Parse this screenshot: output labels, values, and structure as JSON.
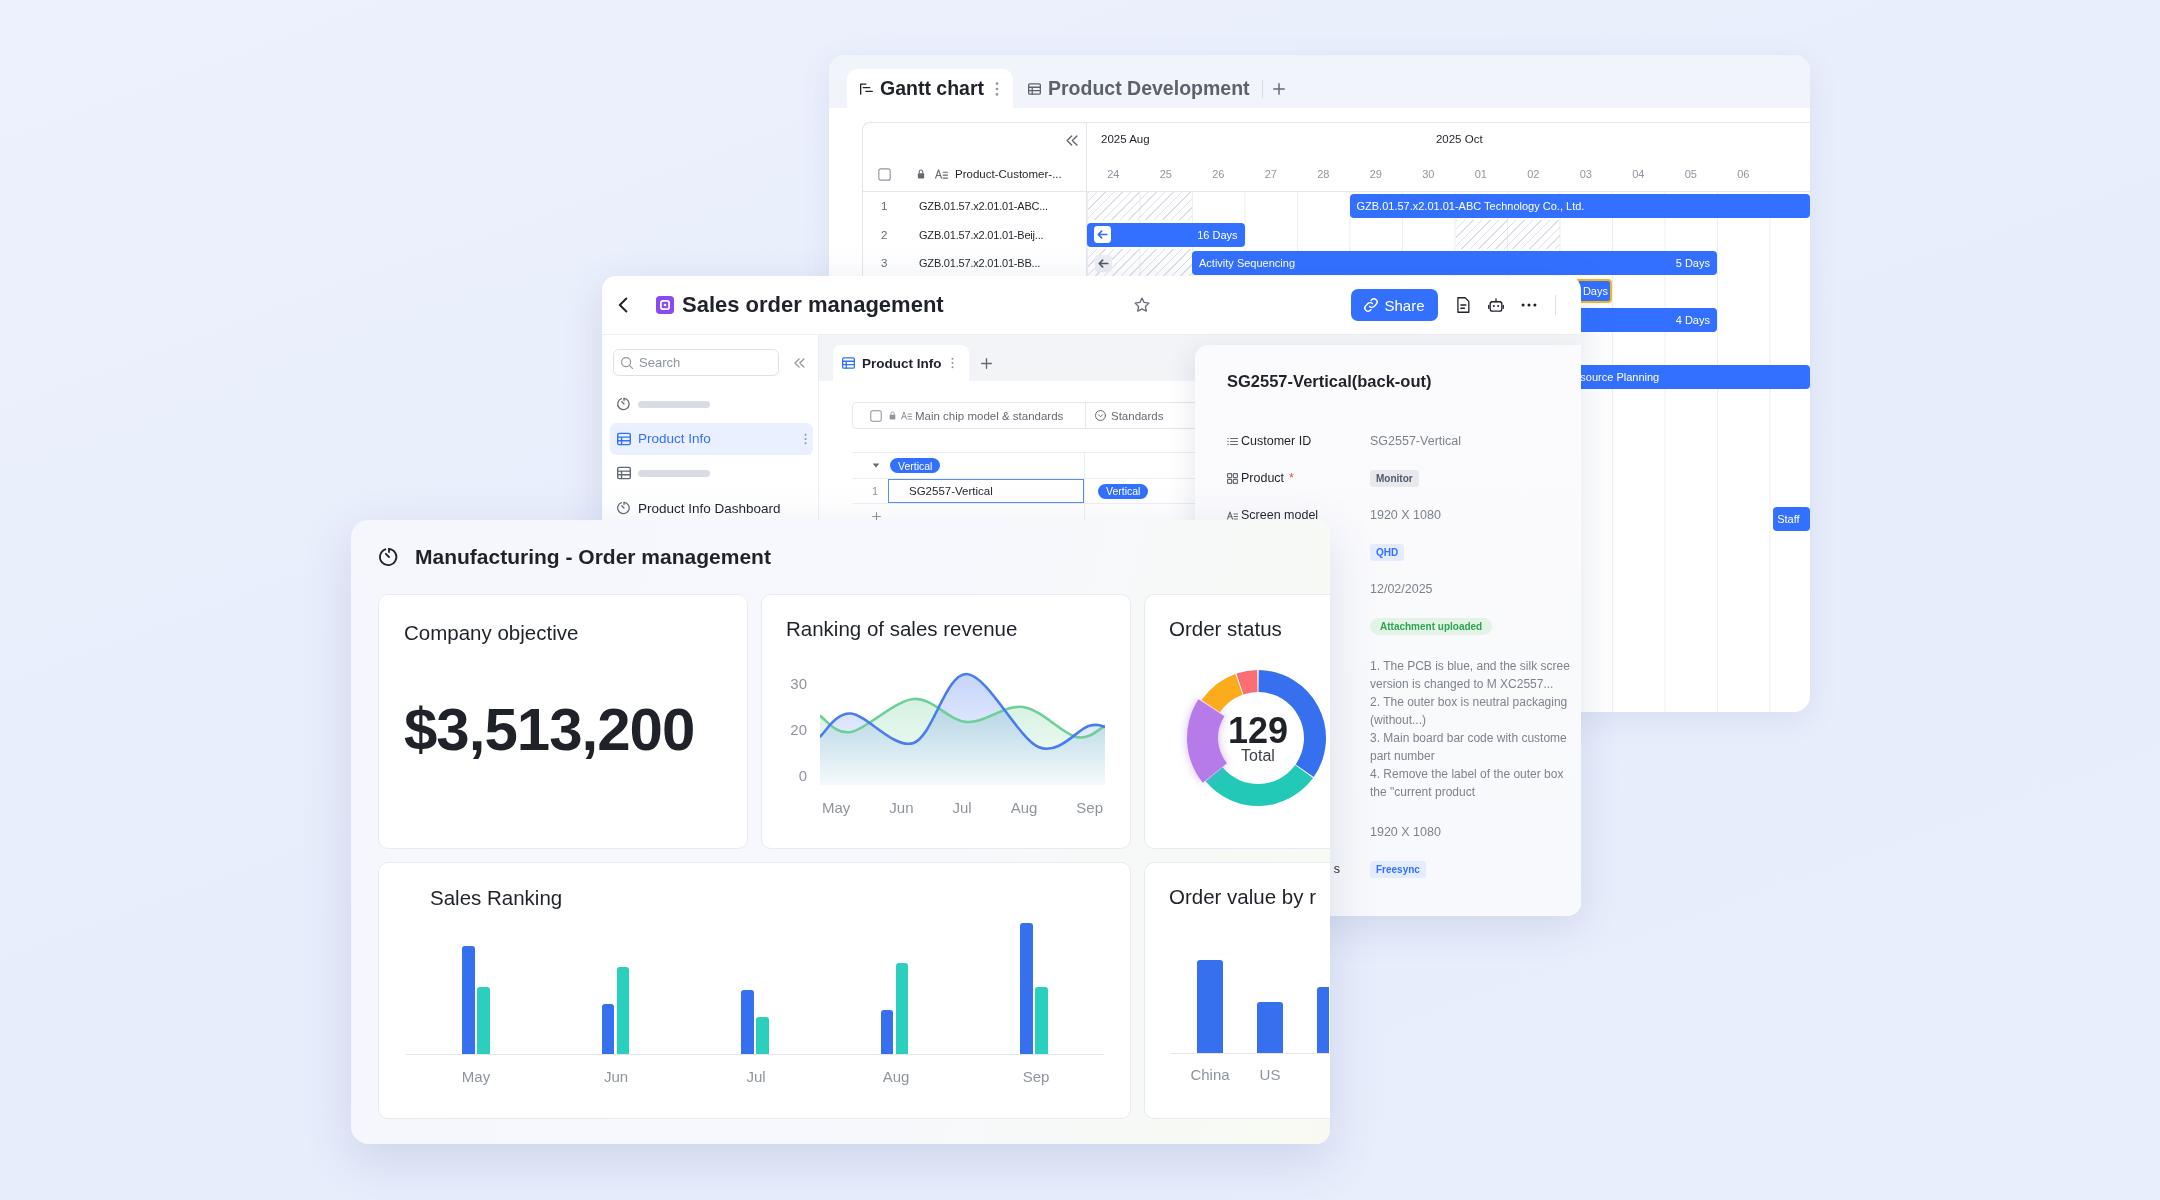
{
  "gantt_window": {
    "tabs": [
      {
        "kind": "gantt",
        "label": "Gantt chart",
        "selected": true
      },
      {
        "kind": "grid",
        "label": "Product Development",
        "selected": false
      }
    ],
    "timeline": {
      "months": [
        "2025 Aug",
        "2025 Oct"
      ],
      "days": [
        "24",
        "25",
        "26",
        "27",
        "28",
        "29",
        "30",
        "01",
        "02",
        "03",
        "04",
        "05",
        "06"
      ]
    },
    "name_column": {
      "label": "Product-Customer-...",
      "checked": false
    },
    "rows": [
      {
        "number": "1",
        "name": "GZB.01.57.x2.01.01-ABC..."
      },
      {
        "number": "2",
        "name": "GZB.01.57.x2.01.01-Beij..."
      },
      {
        "number": "3",
        "name": "GZB.01.57.x2.01.01-BB..."
      }
    ],
    "bars": [
      {
        "label": "GZB.01.57.x2.01.01-ABC Technology Co., Ltd.",
        "selected": false
      },
      {
        "duration": "16 Days",
        "selected": false
      },
      {
        "label": "Activity Sequencing",
        "duration": "5 Days",
        "selected": false
      },
      {
        "duration": "Days",
        "selected": true
      },
      {
        "duration": "4 Days",
        "selected": false
      },
      {
        "label": "source Planning",
        "selected": false
      },
      {
        "label": "Staff",
        "selected": false
      }
    ]
  },
  "sales_window": {
    "title": "Sales order management",
    "share_button": "Share",
    "sidebar": {
      "search": {
        "placeholder": "Search"
      },
      "items": [
        {
          "kind": "dashboard",
          "selected": false
        },
        {
          "kind": "sheet",
          "label": "Product Info",
          "selected": true
        },
        {
          "kind": "sheet",
          "selected": false
        },
        {
          "kind": "dashboard",
          "label": "Product Info Dashboard",
          "selected": false
        }
      ]
    },
    "view_tabs": [
      {
        "label": "Product Info",
        "selected": true
      }
    ],
    "table": {
      "checked": false,
      "columns": [
        {
          "kind": "text",
          "label": "Main chip model & standards"
        },
        {
          "kind": "select",
          "label": "Standards"
        }
      ],
      "groups": [
        {
          "tag": "Vertical",
          "expanded": true,
          "rows": [
            {
              "number": "1",
              "cells": [
                "SG2557-Vertical",
                "Vertical"
              ],
              "selected": true
            }
          ]
        }
      ]
    },
    "detail": {
      "title": "SG2557-Vertical(back-out)",
      "fields": [
        {
          "kind": "id",
          "label": "Customer ID",
          "value": "SG2557-Vertical"
        },
        {
          "kind": "select",
          "label": "Product",
          "required_mark": "*",
          "value": "Monitor",
          "color": "#4e5969"
        },
        {
          "kind": "text",
          "label": "Screen model",
          "value": "1920 X 1080"
        },
        {
          "kind": "select",
          "value": "QHD",
          "color": "#3370ff"
        },
        {
          "kind": "date",
          "value": "12/02/2025"
        },
        {
          "kind": "status",
          "value": "Attachment uploaded",
          "color": "#2ea44f"
        },
        {
          "kind": "long_text",
          "lines": [
            "1. The PCB is blue, and the silk scree",
            "version is changed to M XC2557...",
            "2. The outer box is neutral packaging",
            "(without...)",
            "3. Main board bar code with custome",
            "part number",
            "4. Remove the label of the outer box",
            "the \"current product"
          ]
        },
        {
          "kind": "text",
          "value": "1920 X 1080"
        },
        {
          "kind": "select",
          "label_end": "s",
          "value": "Freesync",
          "color": "#3370ff"
        }
      ]
    }
  },
  "dashboard": {
    "title": "Manufacturing - Order management",
    "objective": {
      "title": "Company objective",
      "value": "$3,513,200"
    },
    "sales_revenue": {
      "title": "Ranking of sales revenue",
      "y_labels": [
        "30",
        "20",
        "0"
      ],
      "x_labels": [
        "May",
        "Jun",
        "Jul",
        "Aug",
        "Sep"
      ]
    },
    "order_status": {
      "title": "Order status",
      "total": "129",
      "total_label": "Total"
    },
    "sales_ranking": {
      "title": "Sales Ranking",
      "x_labels": [
        "May",
        "Jun",
        "Jul",
        "Aug",
        "Sep"
      ]
    },
    "order_value": {
      "title": "Order value by r",
      "x_labels": [
        "China",
        "US"
      ]
    }
  }
}
